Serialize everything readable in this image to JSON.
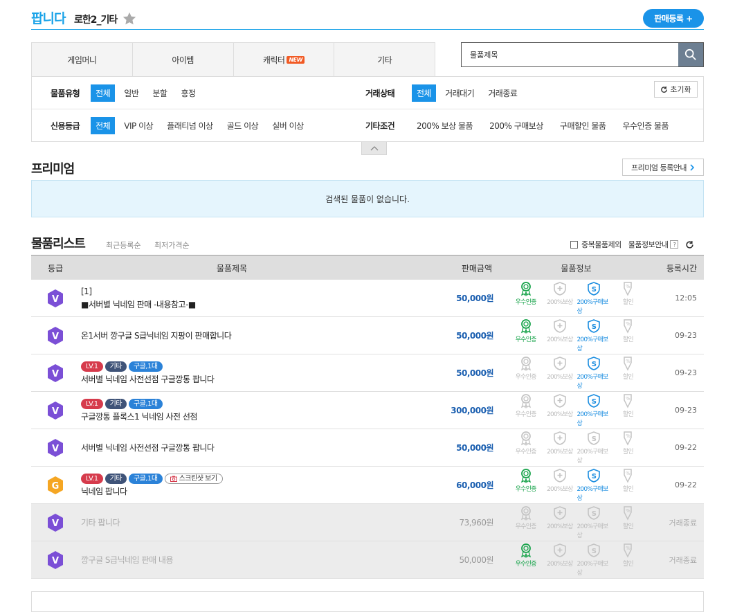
{
  "header": {
    "title": "팝니다",
    "subtitle": "로한2_기타",
    "register_label": "판매등록 +"
  },
  "tabs": [
    {
      "label": "게임머니"
    },
    {
      "label": "아이템"
    },
    {
      "label": "캐릭터",
      "badge": "NEW"
    },
    {
      "label": "기타"
    }
  ],
  "search": {
    "value": "물품제목"
  },
  "filters": {
    "type_label": "물품유형",
    "type_options": [
      "전체",
      "일반",
      "분할",
      "흥정"
    ],
    "status_label": "거래상태",
    "status_options": [
      "전체",
      "거래대기",
      "거래종료"
    ],
    "credit_label": "신용등급",
    "credit_options": [
      "전체",
      "VIP 이상",
      "플래티넘 이상",
      "골드 이상",
      "실버 이상"
    ],
    "etc_label": "기타조건",
    "etc_options": [
      "200% 보상 물품",
      "200% 구매보상",
      "구매할인 물품",
      "우수인증 물품"
    ],
    "reset_label": "초기화"
  },
  "premium": {
    "title": "프리미엄",
    "guide_label": "프리미엄 등록안내",
    "empty": "검색된 물품이 없습니다."
  },
  "list": {
    "title": "물품리스트",
    "sort_recent": "최근등록순",
    "sort_price": "최저가격순",
    "dup_label": "중복물품제외",
    "info_label": "물품정보안내",
    "headers": {
      "grade": "등급",
      "title": "물품제목",
      "price": "판매금액",
      "info": "물품정보",
      "time": "등록시간"
    },
    "info_labels": {
      "cert": "우수인증",
      "comp": "200%보상",
      "buy": "200%구매보상",
      "sale": "할인"
    },
    "rows": [
      {
        "grade": "V",
        "line1": "[1]",
        "title": "■서버별 닉네임 판매 -내용참고-■",
        "price": "50,000원",
        "time": "12:05",
        "cert": true,
        "buy": true
      },
      {
        "grade": "V",
        "title": "온1서버 깡구글 S급닉네임 지팡이 판매합니다",
        "price": "50,000원",
        "time": "09-23",
        "cert": true,
        "buy": true
      },
      {
        "grade": "V",
        "tags": [
          "LV.1",
          "기타",
          "구글,1대"
        ],
        "title": "서버별 닉네임 사전선점 구글깡통 팝니다",
        "price": "50,000원",
        "time": "09-23",
        "cert": false,
        "buy": true
      },
      {
        "grade": "V",
        "tags": [
          "LV.1",
          "기타",
          "구글,1대"
        ],
        "title": "구글깡통 플록스1 닉네임 사전 선점",
        "price": "300,000원",
        "time": "09-23",
        "cert": false,
        "buy": true
      },
      {
        "grade": "V",
        "title": "서버별 닉네임 사전선점 구글깡통 팝니다",
        "price": "50,000원",
        "time": "09-22",
        "cert": false,
        "buy": false
      },
      {
        "grade": "G",
        "tags": [
          "LV.1",
          "기타",
          "구글,1대"
        ],
        "screenshot": "스크린샷 보기",
        "title": "닉네임 팝니다",
        "price": "60,000원",
        "time": "09-22",
        "cert": true,
        "buy": true
      },
      {
        "grade": "V",
        "title": "기타 팝니다",
        "price": "73,960원",
        "time": "거래종료",
        "cert": false,
        "buy": false,
        "closed": true
      },
      {
        "grade": "V",
        "title": "깡구글 S급닉네임 판매 내용",
        "price": "50,000원",
        "time": "거래종료",
        "cert": true,
        "buy": false,
        "closed": true
      }
    ]
  }
}
